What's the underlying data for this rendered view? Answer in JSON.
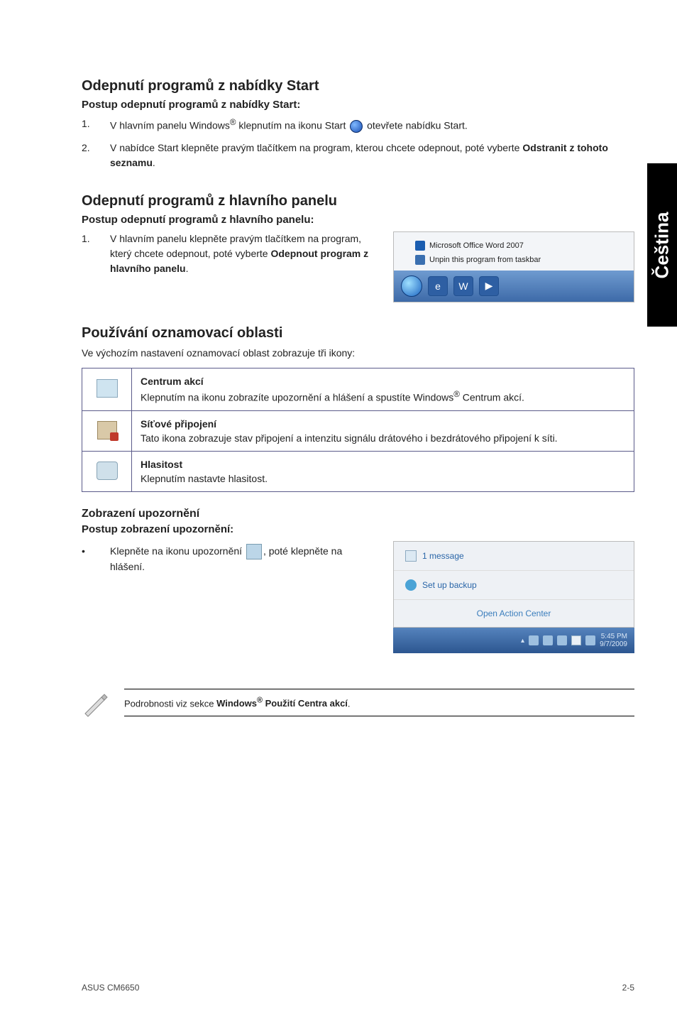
{
  "side_tab": "Čeština",
  "sec1": {
    "title": "Odepnutí programů z nabídky Start",
    "subtitle": "Postup odepnutí programů z nabídky Start:",
    "step1_a": "V hlavním panelu Windows",
    "step1_b": " klepnutím na ikonu Start ",
    "step1_c": " otevřete nabídku Start.",
    "step2_a": "V nabídce Start klepněte pravým tlačítkem na program, kterou chcete odepnout, poté vyberte ",
    "step2_b": "Odstranit z tohoto seznamu",
    "step2_c": "."
  },
  "sec2": {
    "title": "Odepnutí programů z hlavního panelu",
    "subtitle": "Postup odepnutí programů z hlavního panelu:",
    "step1_a": "V hlavním panelu klepněte pravým tlačítkem na program, který chcete odepnout, poté vyberte ",
    "step1_b": "Odepnout program z hlavního panelu",
    "step1_c": "."
  },
  "shot1": {
    "line1": "Microsoft Office Word 2007",
    "line2": "Unpin this program from taskbar"
  },
  "sec3": {
    "title": "Používání oznamovací oblasti",
    "intro": "Ve výchozím nastavení oznamovací oblast zobrazuje tři ikony:"
  },
  "table": {
    "r1_title": "Centrum akcí",
    "r1_body_a": "Klepnutím na ikonu zobrazíte upozornění a hlášení a spustíte Windows",
    "r1_body_b": " Centrum akcí.",
    "r2_title": "Síťové připojení",
    "r2_body": "Tato ikona zobrazuje stav připojení a intenzitu signálu drátového i bezdrátového připojení k síti.",
    "r3_title": "Hlasitost",
    "r3_body": "Klepnutím nastavte hlasitost."
  },
  "sec4": {
    "title": "Zobrazení upozornění",
    "subtitle": "Postup zobrazení upozornění:",
    "bullet_a": "Klepněte na ikonu upozornění ",
    "bullet_b": ", poté klepněte na hlášení."
  },
  "shot2": {
    "line1": "1 message",
    "line2": "Set up backup",
    "line3": "Open Action Center",
    "time": "5:45 PM",
    "date": "9/7/2009"
  },
  "note_a": "Podrobnosti viz sekce ",
  "note_b": "Windows",
  "note_c": " Použití Centra akcí",
  "note_d": ".",
  "footer_left": "ASUS CM6650",
  "footer_right": "2-5"
}
